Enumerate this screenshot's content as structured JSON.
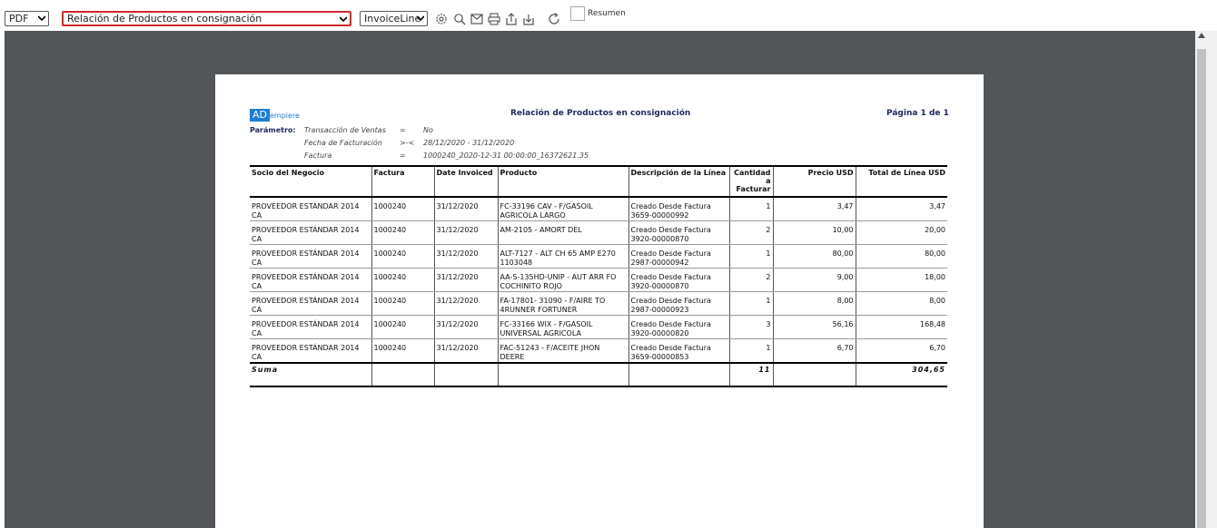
{
  "toolbar": {
    "format_value": "PDF",
    "report_value": "Relación de Productos en consignación",
    "print_format_value": "InvoiceLine",
    "resumen_label": "Resumen"
  },
  "report": {
    "logo_ad": "AD",
    "logo_rest": "empiere",
    "title": "Relación de Productos en consignación",
    "page_label": "Página 1 de 1",
    "param_label": "Parámetro:",
    "parameters": [
      {
        "name": "Transacción de Ventas",
        "op": "=",
        "value": "No"
      },
      {
        "name": "Fecha de Facturación",
        "op": ">-<",
        "value": "28/12/2020 - 31/12/2020"
      },
      {
        "name": "Factura",
        "op": "=",
        "value": "1000240_2020-12-31 00:00:00_16372621.35"
      }
    ],
    "columns": {
      "socio": "Socio del Negocio",
      "factura": "Factura",
      "date": "Date Invoiced",
      "producto": "Producto",
      "descripcion": "Descripción de la Línea",
      "cantidad": "Cantidad a Facturar",
      "precio": "Precio USD",
      "total": "Total de Línea USD"
    },
    "rows": [
      {
        "socio": "PROVEEDOR ESTÁNDAR 2014 CA",
        "factura": "1000240",
        "date": "31/12/2020",
        "producto": "FC-33196 CAV - F/GASOIL AGRICOLA LARGO",
        "descripcion": "Creado Desde Factura 3659-00000992",
        "cantidad": "1",
        "precio": "3,47",
        "total": "3,47"
      },
      {
        "socio": "PROVEEDOR ESTÁNDAR 2014 CA",
        "factura": "1000240",
        "date": "31/12/2020",
        "producto": "AM-2105 - AMORT DEL",
        "descripcion": "Creado Desde Factura 3920-00000870",
        "cantidad": "2",
        "precio": "10,00",
        "total": "20,00"
      },
      {
        "socio": "PROVEEDOR ESTÁNDAR 2014 CA",
        "factura": "1000240",
        "date": "31/12/2020",
        "producto": "ALT-7127 - ALT CH 65 AMP E270 1103048",
        "descripcion": "Creado Desde Factura 2987-00000942",
        "cantidad": "1",
        "precio": "80,00",
        "total": "80,00"
      },
      {
        "socio": "PROVEEDOR ESTÁNDAR 2014 CA",
        "factura": "1000240",
        "date": "31/12/2020",
        "producto": "AA-S-135HD-UNIP - AUT ARR FO COCHINITO ROJO",
        "descripcion": "Creado Desde Factura 3920-00000870",
        "cantidad": "2",
        "precio": "9,00",
        "total": "18,00"
      },
      {
        "socio": "PROVEEDOR ESTÁNDAR 2014 CA",
        "factura": "1000240",
        "date": "31/12/2020",
        "producto": "FA-17801- 31090 - F/AIRE TO 4RUNNER FORTUNER",
        "descripcion": "Creado Desde Factura 2987-00000923",
        "cantidad": "1",
        "precio": "8,00",
        "total": "8,00"
      },
      {
        "socio": "PROVEEDOR ESTÁNDAR 2014 CA",
        "factura": "1000240",
        "date": "31/12/2020",
        "producto": "FC-33166 WIX - F/GASOIL UNIVERSAL AGRICOLA",
        "descripcion": "Creado Desde Factura 3920-00000820",
        "cantidad": "3",
        "precio": "56,16",
        "total": "168,48"
      },
      {
        "socio": "PROVEEDOR ESTÁNDAR 2014 CA",
        "factura": "1000240",
        "date": "31/12/2020",
        "producto": "FAC-51243 - F/ACEITE JHON DEERE",
        "descripcion": "Creado Desde Factura 3659-00000853",
        "cantidad": "1",
        "precio": "6,70",
        "total": "6,70"
      }
    ],
    "sum": {
      "label": "Suma",
      "cantidad": "11",
      "total": "304,65"
    }
  }
}
